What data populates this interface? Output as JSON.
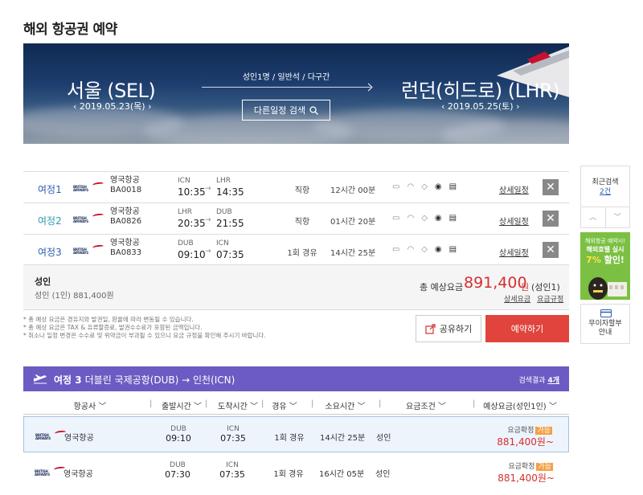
{
  "page_title": "해외 항공권 예약",
  "hero": {
    "from_city": "서울 (SEL)",
    "from_date": "‹ 2019.05.23(목) ›",
    "to_city": "런던(히드로) (LHR)",
    "to_date": "‹ 2019.05.25(토) ›",
    "pax_info": "성인1명 / 일반석 / 다구간",
    "other_search": "다른일정 검색",
    "search_icon": "search-icon"
  },
  "segments": [
    {
      "label": "여정1",
      "airline": "영국항공",
      "flight": "BA0018",
      "dep_code": "ICN",
      "dep_time": "10:35",
      "arr_code": "LHR",
      "arr_time": "14:35",
      "stops": "직항",
      "duration": "12시간 00분",
      "detail": "상세일정"
    },
    {
      "label": "여정2",
      "airline": "영국항공",
      "flight": "BA0826",
      "dep_code": "LHR",
      "dep_time": "20:35",
      "arr_code": "DUB",
      "arr_time": "21:55",
      "stops": "직항",
      "duration": "01시간 20분",
      "detail": "상세일정"
    },
    {
      "label": "여정3",
      "airline": "영국항공",
      "flight": "BA0833",
      "dep_code": "DUB",
      "dep_time": "09:10",
      "arr_code": "ICN",
      "arr_time": "07:35",
      "stops": "1회 경유",
      "duration": "14시간 25분",
      "detail": "상세일정"
    }
  ],
  "ba_logo": {
    "line1": "BRITISH",
    "line2": "AIRWAYS"
  },
  "summary": {
    "adult_title": "성인",
    "adult_sub": "성인 (1인)  881,400원",
    "total_label": "총 예상요금",
    "total_price": "891,400",
    "won": "원",
    "per": "(성인1)",
    "link1": "상세요금",
    "link2": "요금규정"
  },
  "notes": [
    "* 총 예상 요금은 경유지와 발권일, 환율에 따라 변동될 수 있습니다.",
    "* 총 예상 요금은 TAX & 유류할증료, 발권수수료가 포함된 금액입니다.",
    "* 취소나 일정 변경은 수수료 및 위약금이 부과될 수 있으니 요금 규정을 확인해 주시기 바랍니다."
  ],
  "actions": {
    "share": "공유하기",
    "book": "예약하기"
  },
  "side": {
    "recent_label": "최근검색",
    "recent_count": "2건",
    "up": "︿",
    "down": "﹀",
    "ad_line1": "해외항공 예약시!",
    "ad_line2": "해외호텔 실시",
    "ad_pct": "7%",
    "ad_word": " 할인!",
    "pay_label1": "무이자할부",
    "pay_label2": "안내"
  },
  "leg": {
    "num": "여정 3",
    "route": "더블린 국제공항(DUB) → 인천(ICN)",
    "result_label": "검색결과 ",
    "result_count": "4개"
  },
  "sort": [
    "항공사 ﹀",
    "출발시간 ﹀",
    "도착시간 ﹀",
    "경유 ﹀",
    "소요시간 ﹀",
    "요금조건 ﹀",
    "예상요금(성인1인) ﹀"
  ],
  "results": [
    {
      "airline": "영국항공",
      "dep_code": "DUB",
      "dep_time": "09:10",
      "arr_code": "ICN",
      "arr_time": "07:35",
      "stops": "1회 경유",
      "duration": "14시간 25분",
      "class": "성인",
      "confirm": "요금확정",
      "badge": "가능",
      "price": "881,400원~"
    },
    {
      "airline": "영국항공",
      "dep_code": "DUB",
      "dep_time": "07:30",
      "arr_code": "ICN",
      "arr_time": "07:35",
      "stops": "1회 경유",
      "duration": "16시간 05분",
      "class": "성인",
      "confirm": "요금확정",
      "badge": "가능",
      "price": "881,400원~"
    }
  ],
  "colors": {
    "accent": "#6b5bc3",
    "price": "#d52f2f",
    "book": "#e0443c",
    "link": "#2d5fb3"
  }
}
